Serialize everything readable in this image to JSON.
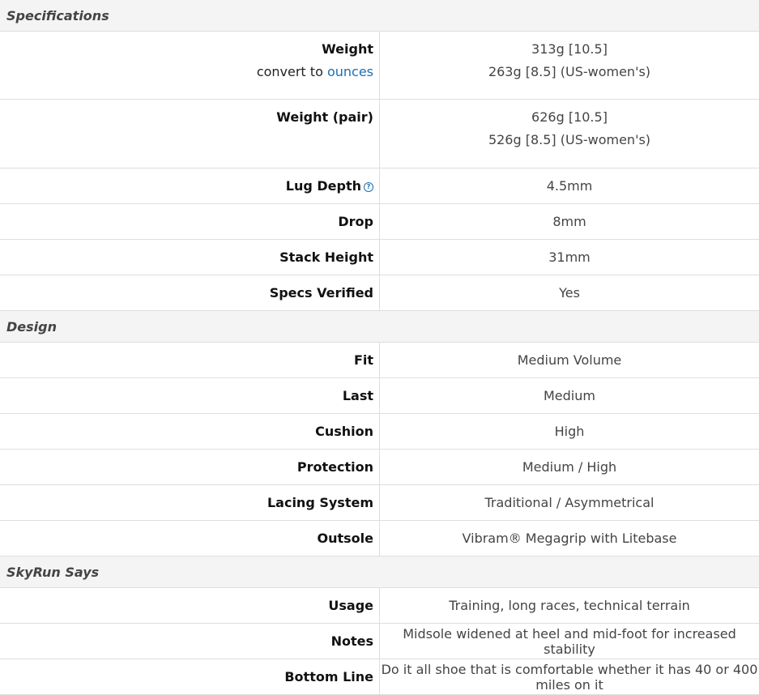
{
  "sections": {
    "specifications": "Specifications",
    "design": "Design",
    "skyrun": "SkyRun Says"
  },
  "weight": {
    "label": "Weight",
    "convert_prefix": "convert to",
    "convert_link": "ounces",
    "value_line1": "313g [10.5]",
    "value_line2": "263g [8.5] (US-women's)"
  },
  "weight_pair": {
    "label": "Weight (pair)",
    "value_line1": "626g [10.5]",
    "value_line2": "526g [8.5] (US-women's)"
  },
  "lug_depth": {
    "label": "Lug Depth",
    "value": "4.5mm",
    "help_icon": "?"
  },
  "drop": {
    "label": "Drop",
    "value": "8mm"
  },
  "stack_height": {
    "label": "Stack Height",
    "value": "31mm"
  },
  "specs_verified": {
    "label": "Specs Verified",
    "value": "Yes"
  },
  "fit": {
    "label": "Fit",
    "value": "Medium Volume"
  },
  "last": {
    "label": "Last",
    "value": "Medium"
  },
  "cushion": {
    "label": "Cushion",
    "value": "High"
  },
  "protection": {
    "label": "Protection",
    "value": "Medium / High"
  },
  "lacing": {
    "label": "Lacing System",
    "value": "Traditional / Asymmetrical"
  },
  "outsole": {
    "label": "Outsole",
    "value": "Vibram® Megagrip with Litebase"
  },
  "usage": {
    "label": "Usage",
    "value": "Training, long races, technical terrain"
  },
  "notes": {
    "label": "Notes",
    "value": "Midsole widened at heel and mid-foot for increased stability"
  },
  "bottom_line": {
    "label": "Bottom Line",
    "value": "Do it all shoe that is comfortable whether it has 40 or 400 miles on it"
  }
}
